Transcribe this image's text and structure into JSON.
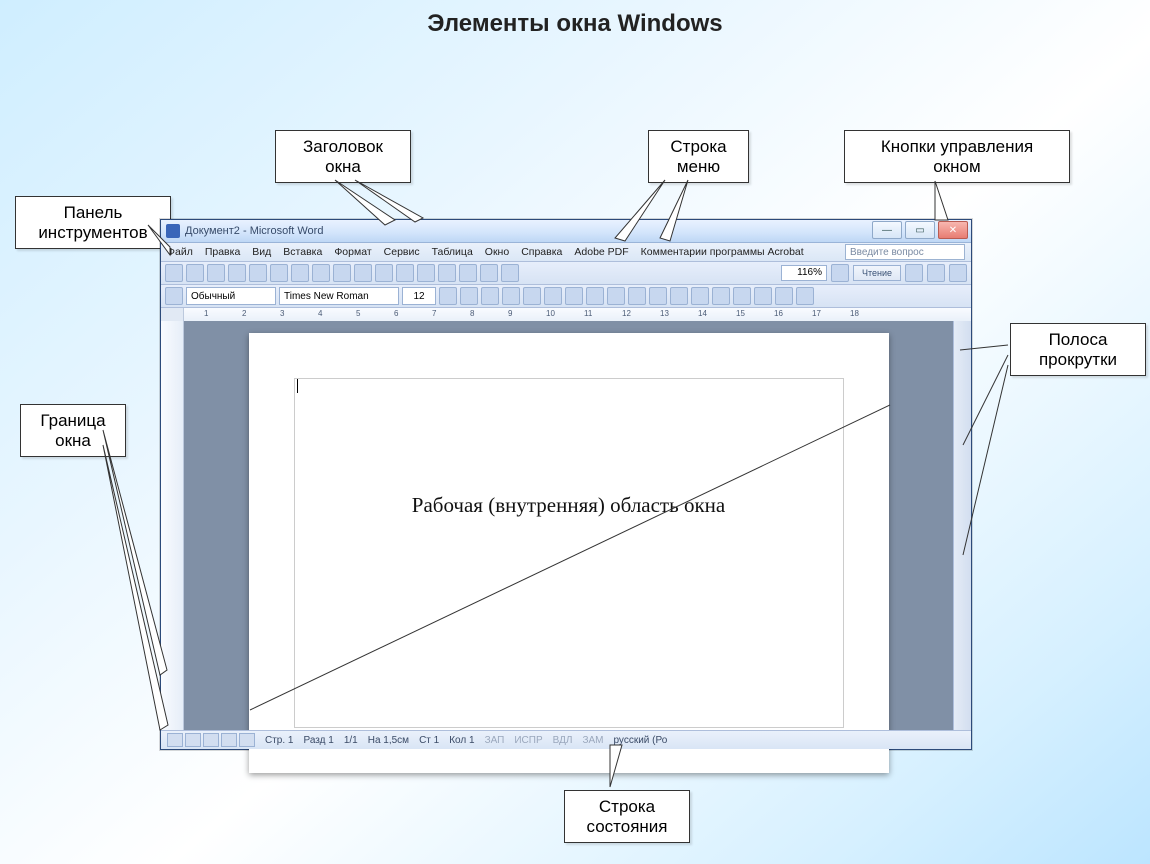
{
  "page_title": "Элементы окна Windows",
  "callouts": {
    "title_bar": "Заголовок\nокна",
    "menu_bar": "Строка\nменю",
    "window_buttons": "Кнопки управления\nокном",
    "toolbar": "Панель\nинструментов",
    "scrollbar": "Полоса\nпрокрутки",
    "border": "Граница\nокна",
    "statusbar": "Строка\nсостояния"
  },
  "titlebar_text": "Документ2 - Microsoft Word",
  "menu_items": [
    "Файл",
    "Правка",
    "Вид",
    "Вставка",
    "Формат",
    "Сервис",
    "Таблица",
    "Окно",
    "Справка",
    "Adobe PDF",
    "Комментарии программы Acrobat"
  ],
  "ask_placeholder": "Введите вопрос",
  "zoom_value": "116%",
  "read_label": "Чтение",
  "style_combo": "Обычный",
  "font_combo": "Times New Roman",
  "size_combo": "12",
  "ruler_ticks": [
    "1",
    "2",
    "3",
    "4",
    "5",
    "6",
    "7",
    "8",
    "9",
    "10",
    "11",
    "12",
    "13",
    "14",
    "15",
    "16",
    "17",
    "18"
  ],
  "document_text": "Рабочая (внутренняя) область окна",
  "status": {
    "page": "Стр. 1",
    "section": "Разд 1",
    "pages": "1/1",
    "pos": "На 1,5см",
    "line": "Ст 1",
    "col": "Кол 1",
    "rec": "ЗАП",
    "trk": "ИСПР",
    "ext": "ВДЛ",
    "ovr": "ЗАМ",
    "lang": "русский (Ро"
  }
}
